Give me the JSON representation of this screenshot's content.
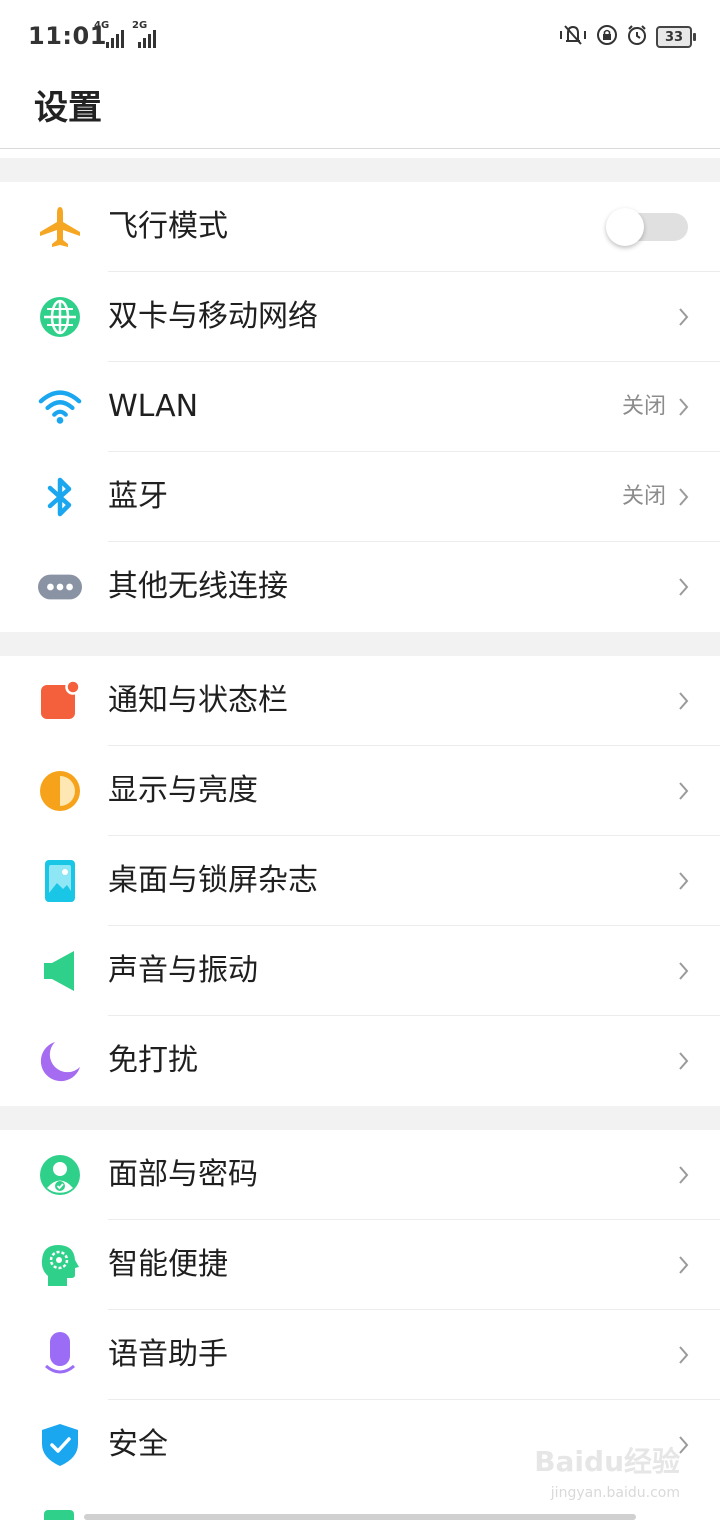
{
  "status_bar": {
    "time": "11:01",
    "sim1_label": "4G",
    "sim2_label": "2G",
    "battery": "33",
    "icons": [
      "mute-icon",
      "rotation-lock-icon",
      "alarm-icon",
      "battery-icon"
    ]
  },
  "header": {
    "title": "设置"
  },
  "groups": [
    {
      "items": [
        {
          "label": "飞行模式",
          "icon": "airplane-icon",
          "toggle": false
        },
        {
          "label": "双卡与移动网络",
          "icon": "globe-icon"
        },
        {
          "label": "WLAN",
          "icon": "wifi-icon",
          "value": "关闭"
        },
        {
          "label": "蓝牙",
          "icon": "bluetooth-icon",
          "value": "关闭"
        },
        {
          "label": "其他无线连接",
          "icon": "more-dots-icon"
        }
      ]
    },
    {
      "items": [
        {
          "label": "通知与状态栏",
          "icon": "notification-icon"
        },
        {
          "label": "显示与亮度",
          "icon": "brightness-icon"
        },
        {
          "label": "桌面与锁屏杂志",
          "icon": "wallpaper-icon"
        },
        {
          "label": "声音与振动",
          "icon": "speaker-icon"
        },
        {
          "label": "免打扰",
          "icon": "moon-icon"
        }
      ]
    },
    {
      "items": [
        {
          "label": "面部与密码",
          "icon": "face-lock-icon"
        },
        {
          "label": "智能便捷",
          "icon": "smart-head-icon"
        },
        {
          "label": "语音助手",
          "icon": "microphone-icon"
        },
        {
          "label": "安全",
          "icon": "shield-icon"
        }
      ]
    }
  ],
  "watermark": {
    "text": "Baidu经验",
    "sub": "jingyan.baidu.com"
  },
  "colors": {
    "airplane": "#f5a623",
    "globe": "#2fd08a",
    "wifi": "#1ba6f0",
    "bluetooth": "#1ba6f0",
    "dots": "#8a93a3",
    "notification": "#f4603c",
    "brightness": "#f7a21b",
    "wallpaper": "#19c6e6",
    "speaker": "#2fd08a",
    "moon": "#a56cf2",
    "face": "#2fd08a",
    "smart": "#2fd08a",
    "mic": "#9b6cf5",
    "shield": "#1ba6f0"
  }
}
